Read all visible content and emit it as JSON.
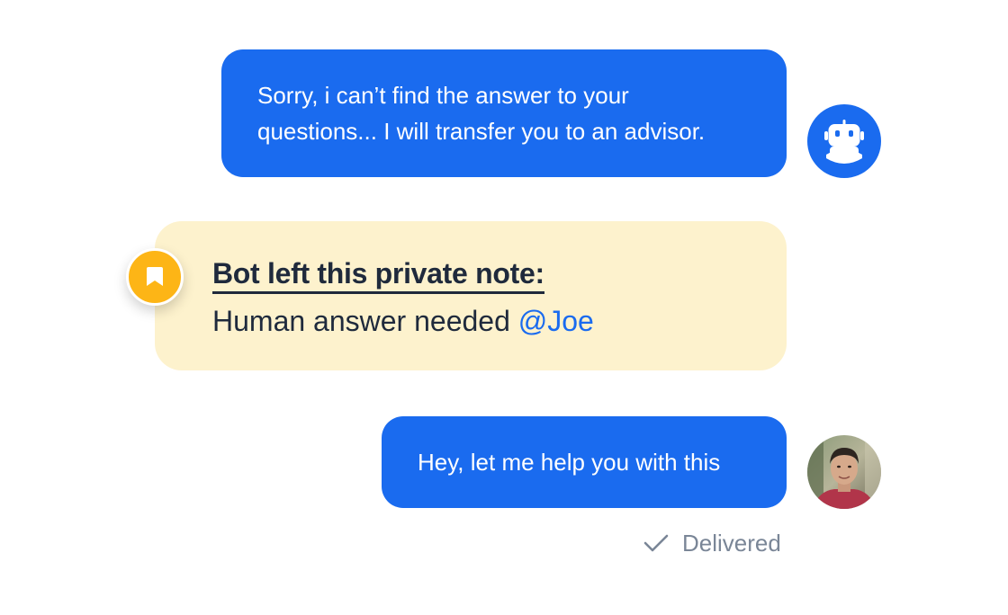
{
  "messages": {
    "bot": {
      "line1": "Sorry, i can’t find the answer to your",
      "line2": "questions... I will transfer you to an advisor.",
      "avatar_icon": "robot-icon"
    },
    "note": {
      "title": "Bot left this private note:",
      "body": "Human answer needed ",
      "mention": "@Joe",
      "badge_icon": "bookmark-icon"
    },
    "human": {
      "text": "Hey, let me help you with this",
      "avatar": "agent-photo"
    }
  },
  "status": {
    "icon": "checkmark-icon",
    "label": "Delivered"
  },
  "colors": {
    "bubble": "#1a6bef",
    "note_bg": "#fdf2cd",
    "badge": "#fdb516",
    "mention": "#1a6bef",
    "status_text": "#7a8697"
  }
}
